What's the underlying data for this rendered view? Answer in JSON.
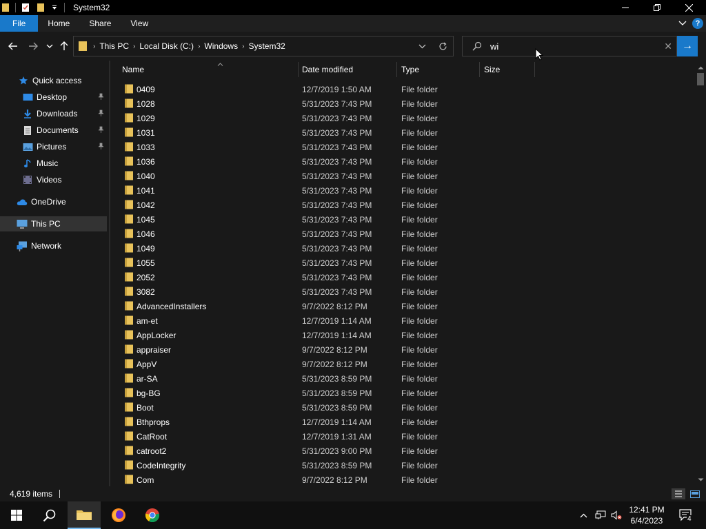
{
  "window": {
    "title": "System32",
    "minimize_glyph": "—",
    "maximize_glyph": "❐",
    "close_glyph": "✕"
  },
  "ribbon": {
    "tabs": [
      {
        "label": "File"
      },
      {
        "label": "Home"
      },
      {
        "label": "Share"
      },
      {
        "label": "View"
      }
    ],
    "expand_glyph": "⌄",
    "help_glyph": "?"
  },
  "address": {
    "crumbs": [
      "This PC",
      "Local Disk (C:)",
      "Windows",
      "System32"
    ],
    "separator": "›"
  },
  "search": {
    "value": "wi",
    "placeholder": "",
    "clear_glyph": "✕",
    "go_glyph": "→"
  },
  "sidebar": {
    "items": [
      {
        "label": "Quick access",
        "icon": "star-icon",
        "pinned": false
      },
      {
        "label": "Desktop",
        "icon": "desktop-icon",
        "pinned": true
      },
      {
        "label": "Downloads",
        "icon": "download-icon",
        "pinned": true
      },
      {
        "label": "Documents",
        "icon": "document-icon",
        "pinned": true
      },
      {
        "label": "Pictures",
        "icon": "pictures-icon",
        "pinned": true
      },
      {
        "label": "Music",
        "icon": "music-icon",
        "pinned": false
      },
      {
        "label": "Videos",
        "icon": "videos-icon",
        "pinned": false
      },
      {
        "label": "OneDrive",
        "icon": "cloud-icon",
        "pinned": false
      },
      {
        "label": "This PC",
        "icon": "computer-icon",
        "pinned": false,
        "selected": true
      },
      {
        "label": "Network",
        "icon": "network-icon",
        "pinned": false
      }
    ]
  },
  "columns": {
    "name": "Name",
    "date": "Date modified",
    "type": "Type",
    "size": "Size"
  },
  "files": [
    {
      "name": "0409",
      "date": "12/7/2019 1:50 AM",
      "type": "File folder"
    },
    {
      "name": "1028",
      "date": "5/31/2023 7:43 PM",
      "type": "File folder"
    },
    {
      "name": "1029",
      "date": "5/31/2023 7:43 PM",
      "type": "File folder"
    },
    {
      "name": "1031",
      "date": "5/31/2023 7:43 PM",
      "type": "File folder"
    },
    {
      "name": "1033",
      "date": "5/31/2023 7:43 PM",
      "type": "File folder"
    },
    {
      "name": "1036",
      "date": "5/31/2023 7:43 PM",
      "type": "File folder"
    },
    {
      "name": "1040",
      "date": "5/31/2023 7:43 PM",
      "type": "File folder"
    },
    {
      "name": "1041",
      "date": "5/31/2023 7:43 PM",
      "type": "File folder"
    },
    {
      "name": "1042",
      "date": "5/31/2023 7:43 PM",
      "type": "File folder"
    },
    {
      "name": "1045",
      "date": "5/31/2023 7:43 PM",
      "type": "File folder"
    },
    {
      "name": "1046",
      "date": "5/31/2023 7:43 PM",
      "type": "File folder"
    },
    {
      "name": "1049",
      "date": "5/31/2023 7:43 PM",
      "type": "File folder"
    },
    {
      "name": "1055",
      "date": "5/31/2023 7:43 PM",
      "type": "File folder"
    },
    {
      "name": "2052",
      "date": "5/31/2023 7:43 PM",
      "type": "File folder"
    },
    {
      "name": "3082",
      "date": "5/31/2023 7:43 PM",
      "type": "File folder"
    },
    {
      "name": "AdvancedInstallers",
      "date": "9/7/2022 8:12 PM",
      "type": "File folder"
    },
    {
      "name": "am-et",
      "date": "12/7/2019 1:14 AM",
      "type": "File folder"
    },
    {
      "name": "AppLocker",
      "date": "12/7/2019 1:14 AM",
      "type": "File folder"
    },
    {
      "name": "appraiser",
      "date": "9/7/2022 8:12 PM",
      "type": "File folder"
    },
    {
      "name": "AppV",
      "date": "9/7/2022 8:12 PM",
      "type": "File folder"
    },
    {
      "name": "ar-SA",
      "date": "5/31/2023 8:59 PM",
      "type": "File folder"
    },
    {
      "name": "bg-BG",
      "date": "5/31/2023 8:59 PM",
      "type": "File folder"
    },
    {
      "name": "Boot",
      "date": "5/31/2023 8:59 PM",
      "type": "File folder"
    },
    {
      "name": "Bthprops",
      "date": "12/7/2019 1:14 AM",
      "type": "File folder"
    },
    {
      "name": "CatRoot",
      "date": "12/7/2019 1:31 AM",
      "type": "File folder"
    },
    {
      "name": "catroot2",
      "date": "5/31/2023 9:00 PM",
      "type": "File folder"
    },
    {
      "name": "CodeIntegrity",
      "date": "5/31/2023 8:59 PM",
      "type": "File folder"
    },
    {
      "name": "Com",
      "date": "9/7/2022 8:12 PM",
      "type": "File folder"
    }
  ],
  "status": {
    "item_count": "4,619 items"
  },
  "taskbar": {
    "time": "12:41 PM",
    "date": "6/4/2023",
    "notification_count": "4"
  },
  "colors": {
    "accent": "#1979ca",
    "folder": "#e8c25a",
    "background": "#191919"
  }
}
